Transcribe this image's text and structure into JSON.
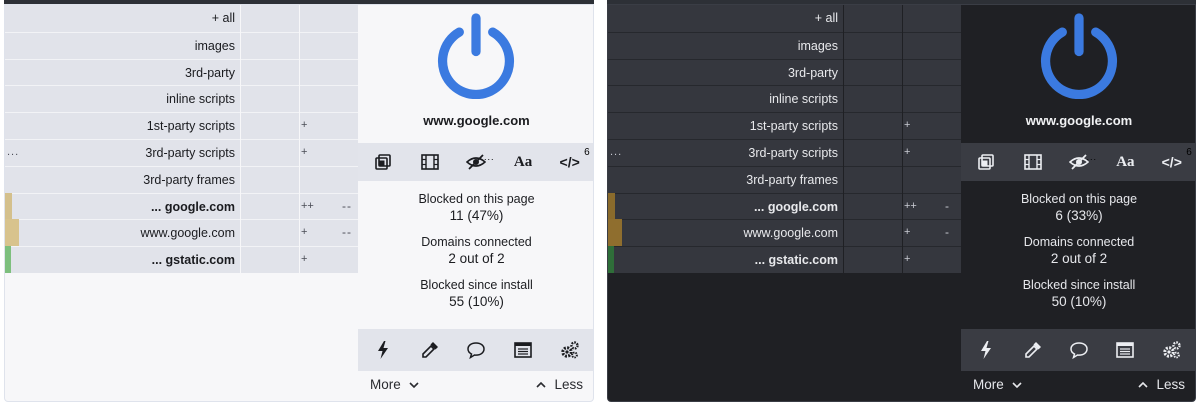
{
  "panels": [
    {
      "theme": "light",
      "rows": [
        {
          "name": "+ all",
          "bold": false,
          "mid": "",
          "right": "",
          "dots": "",
          "swatch": ""
        },
        {
          "name": "images",
          "bold": false,
          "mid": "",
          "right": "",
          "dots": "",
          "swatch": ""
        },
        {
          "name": "3rd-party",
          "bold": false,
          "mid": "",
          "right": "",
          "dots": "",
          "swatch": ""
        },
        {
          "name": "inline scripts",
          "bold": false,
          "mid": "",
          "right": "",
          "dots": "",
          "swatch": ""
        },
        {
          "name": "1st-party scripts",
          "bold": false,
          "mid": "+",
          "right": "",
          "dots": "",
          "swatch": ""
        },
        {
          "name": "3rd-party scripts",
          "bold": false,
          "mid": "+",
          "right": "",
          "dots": "...",
          "swatch": ""
        },
        {
          "name": "3rd-party frames",
          "bold": false,
          "mid": "",
          "right": "",
          "dots": "",
          "swatch": ""
        },
        {
          "name": "... google.com",
          "bold": true,
          "mid": "++",
          "right": "--",
          "dots": "",
          "swatch": "#d4c08c"
        },
        {
          "name": "www.google.com",
          "bold": false,
          "mid": "+",
          "right": "--",
          "dots": "",
          "swatch": "#d8c38d"
        },
        {
          "name": "... gstatic.com",
          "bold": true,
          "mid": "+",
          "right": "",
          "dots": "",
          "swatch": "#7dbf7d"
        }
      ],
      "hostname": "www.google.com",
      "toolbar_top": {
        "scripts_count": "6",
        "more_dots": "..."
      },
      "stats": [
        {
          "label": "Blocked on this page",
          "value": "11 (47%)"
        },
        {
          "label": "Domains connected",
          "value": "2 out of 2"
        },
        {
          "label": "Blocked since install",
          "value": "55 (10%)"
        }
      ],
      "more_label": "More",
      "less_label": "Less",
      "colors": {
        "power": "#3b7ae0",
        "background": "#f7f7f9"
      }
    },
    {
      "theme": "dark",
      "rows": [
        {
          "name": "+ all",
          "bold": false,
          "mid": "",
          "right": "",
          "dots": "",
          "swatch": ""
        },
        {
          "name": "images",
          "bold": false,
          "mid": "",
          "right": "",
          "dots": "",
          "swatch": ""
        },
        {
          "name": "3rd-party",
          "bold": false,
          "mid": "",
          "right": "",
          "dots": "",
          "swatch": ""
        },
        {
          "name": "inline scripts",
          "bold": false,
          "mid": "",
          "right": "",
          "dots": "",
          "swatch": ""
        },
        {
          "name": "1st-party scripts",
          "bold": false,
          "mid": "+",
          "right": "",
          "dots": "",
          "swatch": ""
        },
        {
          "name": "3rd-party scripts",
          "bold": false,
          "mid": "+",
          "right": "",
          "dots": "...",
          "swatch": ""
        },
        {
          "name": "3rd-party frames",
          "bold": false,
          "mid": "",
          "right": "",
          "dots": "",
          "swatch": ""
        },
        {
          "name": "... google.com",
          "bold": true,
          "mid": "++",
          "right": "-",
          "dots": "",
          "swatch": "#8a6b2c"
        },
        {
          "name": "www.google.com",
          "bold": false,
          "mid": "+",
          "right": "-",
          "dots": "",
          "swatch": "#8f6e2e"
        },
        {
          "name": "... gstatic.com",
          "bold": true,
          "mid": "+",
          "right": "",
          "dots": "",
          "swatch": "#2f6e39"
        }
      ],
      "hostname": "www.google.com",
      "toolbar_top": {
        "scripts_count": "6",
        "more_dots": "..."
      },
      "stats": [
        {
          "label": "Blocked on this page",
          "value": "6 (33%)"
        },
        {
          "label": "Domains connected",
          "value": "2 out of 2"
        },
        {
          "label": "Blocked since install",
          "value": "50 (10%)"
        }
      ],
      "more_label": "More",
      "less_label": "Less",
      "colors": {
        "power": "#3b7ae0",
        "background": "#1f2024"
      }
    }
  ],
  "icons": {
    "toolbar_top": [
      "popup-block-icon",
      "media-icon",
      "cosmetic-filter-icon",
      "remote-font-icon",
      "javascript-icon"
    ],
    "toolbar_bottom": [
      "zapper-icon",
      "element-picker-icon",
      "report-icon",
      "logger-icon",
      "dashboard-gears-icon"
    ]
  }
}
